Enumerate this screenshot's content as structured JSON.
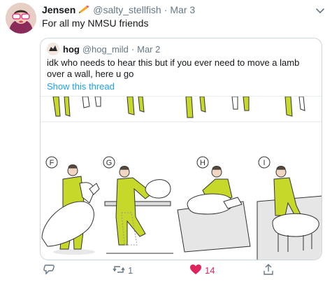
{
  "tweet": {
    "author_name": "Jensen",
    "author_handle": "@salty_stellfish",
    "separator": "·",
    "date": "Mar 3",
    "text": "For all my NMSU friends"
  },
  "quoted": {
    "author_name": "hog",
    "author_handle": "@hog_mild",
    "separator": "·",
    "date": "Mar 2",
    "text": "idk who needs to hear this but if you ever need to move a lamb over a wall, here u go",
    "show_thread": "Show this thread",
    "panel_labels": [
      "F",
      "G",
      "H",
      "I"
    ]
  },
  "actions": {
    "reply_count": "",
    "retweet_count": "1",
    "like_count": "14",
    "like_color": "#e0245e"
  },
  "icons": [
    "pencil-emoji-icon",
    "chevron-down-icon",
    "reply-icon",
    "retweet-icon",
    "heart-icon",
    "share-icon"
  ],
  "colors": {
    "link": "#1da1f2",
    "muted": "#657786",
    "figure_yellow": "#c6d92a",
    "like": "#e0245e"
  }
}
